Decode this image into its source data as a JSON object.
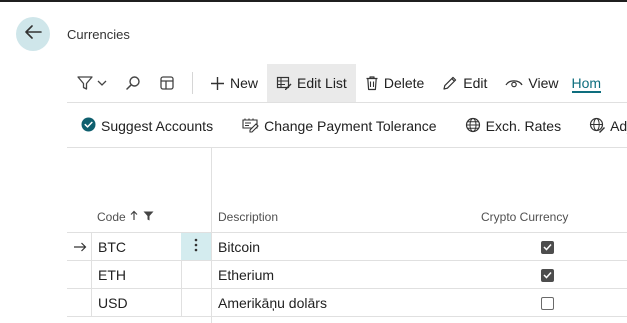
{
  "page": {
    "title": "Currencies"
  },
  "ribbon": {
    "new_label": "New",
    "edit_list_label": "Edit List",
    "delete_label": "Delete",
    "edit_label": "Edit",
    "view_label": "View",
    "home_tab_label": "Hom"
  },
  "actions": {
    "suggest_accounts": "Suggest Accounts",
    "change_payment_tolerance": "Change Payment Tolerance",
    "exch_rates": "Exch. Rates",
    "adjust": "Adjust"
  },
  "table": {
    "columns": {
      "code": "Code",
      "description": "Description",
      "crypto": "Crypto Currency"
    },
    "rows": [
      {
        "code": "BTC",
        "description": "Bitcoin",
        "crypto": true
      },
      {
        "code": "ETH",
        "description": "Etherium",
        "crypto": true
      },
      {
        "code": "USD",
        "description": "Amerikāņu dolārs",
        "crypto": false
      }
    ]
  },
  "colors": {
    "accent": "#0e6e7e",
    "back_button_bg": "#cfe6ea",
    "selected_cell_bg": "#d4ecef"
  }
}
